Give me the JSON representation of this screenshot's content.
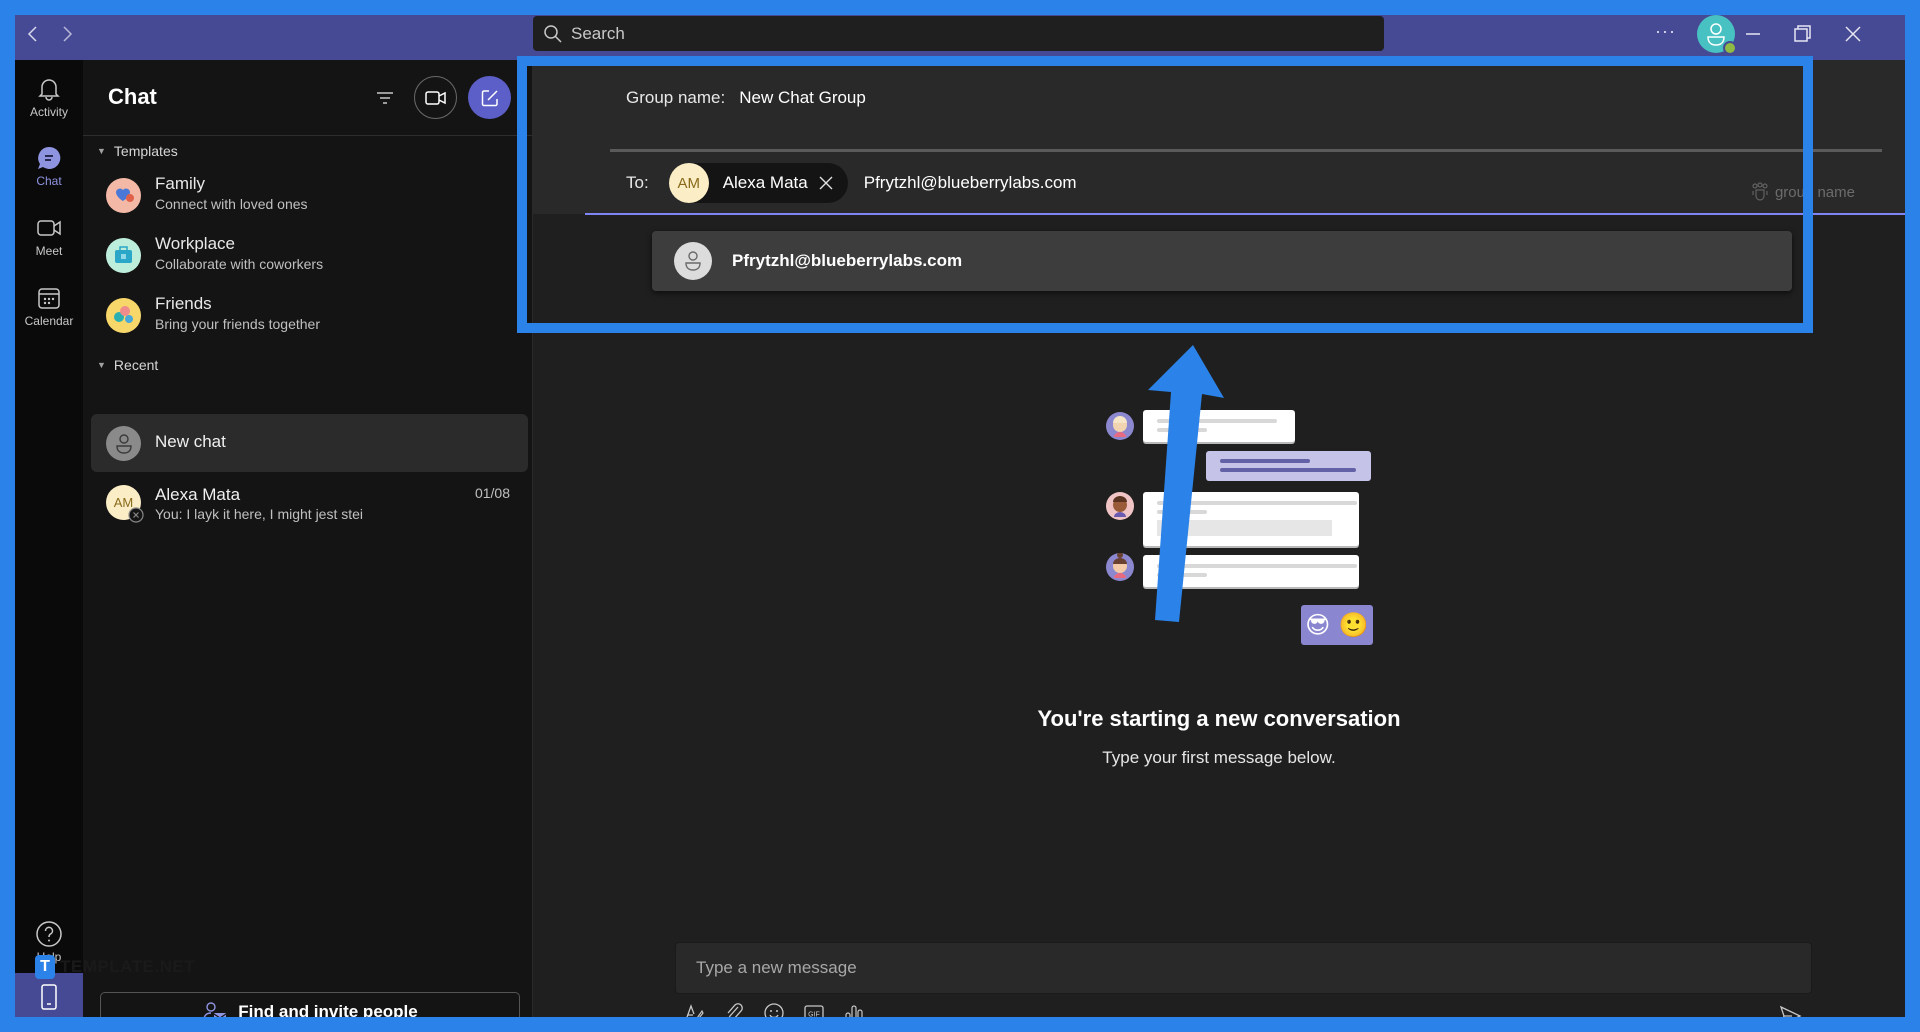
{
  "titlebar": {
    "back_icon": "chevron-left-icon",
    "forward_icon": "chevron-right-icon",
    "search_placeholder": "Search",
    "more_label": "···",
    "window_controls": [
      "minimize",
      "restore",
      "close"
    ]
  },
  "rail": {
    "items": [
      {
        "label": "Activity",
        "icon": "bell-icon",
        "active": false
      },
      {
        "label": "Chat",
        "icon": "chat-icon",
        "active": true
      },
      {
        "label": "Meet",
        "icon": "video-icon",
        "active": false
      },
      {
        "label": "Calendar",
        "icon": "calendar-icon",
        "active": false
      }
    ],
    "help_label": "Help"
  },
  "chat_panel": {
    "title": "Chat",
    "templates_label": "Templates",
    "templates": [
      {
        "name": "Family",
        "subtitle": "Connect with loved ones",
        "color": "#f3b8a6"
      },
      {
        "name": "Workplace",
        "subtitle": "Collaborate with coworkers",
        "color": "#bdeedc"
      },
      {
        "name": "Friends",
        "subtitle": "Bring your friends together",
        "color": "#f7d66a"
      }
    ],
    "recent_label": "Recent",
    "recent": [
      {
        "name": "New chat",
        "preview": "",
        "date": "",
        "selected": true
      },
      {
        "name": "Alexa Mata",
        "initials": "AM",
        "preview": "You: I layk it here, I might jest stei",
        "date": "01/08",
        "selected": false
      }
    ],
    "find_invite_label": "Find and invite people"
  },
  "watermark": {
    "logo_letter": "T",
    "text": "TEMPLATE.NET"
  },
  "new_chat": {
    "group_name_label": "Group name:",
    "group_name_value": "New Chat Group",
    "to_label": "To:",
    "recipients": [
      {
        "name": "Alexa Mata",
        "initials": "AM"
      }
    ],
    "to_input_value": "Pfrytzhl@blueberrylabs.com",
    "group_name_hint": "group name",
    "suggestion_email": "Pfrytzhl@blueberrylabs.com"
  },
  "empty_state": {
    "title": "You're starting a new conversation",
    "subtitle": "Type your first message below.",
    "emojis": [
      "😎",
      "🙂"
    ]
  },
  "composer": {
    "placeholder": "Type a new message",
    "tools": [
      "format-icon",
      "attach-icon",
      "emoji-icon",
      "gif-icon",
      "poll-icon"
    ],
    "send_icon": "send-icon"
  },
  "colors": {
    "accent": "#5b5fc7",
    "titlebar": "#464a94",
    "annotation_blue": "#2b83ea",
    "underline": "#7f85f5"
  }
}
